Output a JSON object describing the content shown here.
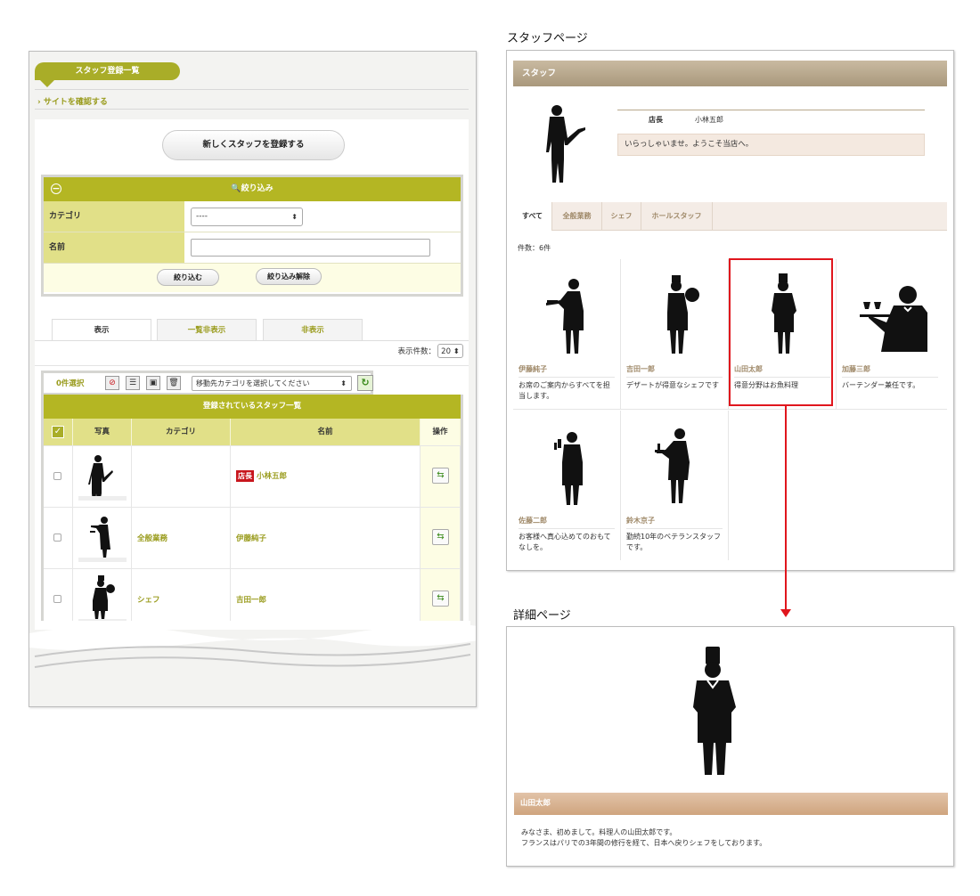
{
  "admin": {
    "tab_title": "スタッフ登録一覧",
    "site_link": "› サイトを確認する",
    "new_button": "新しくスタッフを登録する",
    "filter": {
      "title": "🔍絞り込み",
      "category_label": "カテゴリ",
      "category_value": "----",
      "name_label": "名前",
      "name_value": "",
      "apply_button": "絞り込む",
      "clear_button": "絞り込み解除"
    },
    "tabs": [
      "表示",
      "一覧非表示",
      "非表示"
    ],
    "per_page_label": "表示件数：",
    "per_page_value": "20",
    "toolbar": {
      "selected_count": "0件選択",
      "move_category_placeholder": "移動先カテゴリを選択してください"
    },
    "table": {
      "title": "登録されているスタッフ一覧",
      "columns": [
        "写真",
        "カテゴリ",
        "名前",
        "操作"
      ],
      "rows": [
        {
          "category": "",
          "badge": "店長",
          "name": "小林五郎"
        },
        {
          "category": "全般業務",
          "badge": "",
          "name": "伊藤純子"
        },
        {
          "category": "シェフ",
          "badge": "",
          "name": "吉田一郎"
        }
      ]
    }
  },
  "staff_page": {
    "caption": "スタッフページ",
    "header": "スタッフ",
    "manager": {
      "role": "店長",
      "name": "小林五郎",
      "greeting": "いらっしゃいませ。ようこそ当店へ。"
    },
    "tabs": [
      "すべて",
      "全般業務",
      "シェフ",
      "ホールスタッフ"
    ],
    "count": "件数：6件",
    "staff": [
      {
        "name": "伊藤純子",
        "desc": "お席のご案内からすべてを担当します。"
      },
      {
        "name": "吉田一郎",
        "desc": "デザートが得意なシェフです"
      },
      {
        "name": "山田太郎",
        "desc": "得意分野はお魚料理"
      },
      {
        "name": "加藤三郎",
        "desc": "バーテンダー兼任です。"
      },
      {
        "name": "佐藤二郎",
        "desc": "お客様へ真心込めてのおもてなしを。"
      },
      {
        "name": "鈴木京子",
        "desc": "勤続10年のベテランスタッフです。"
      }
    ]
  },
  "detail_page": {
    "caption": "詳細ページ",
    "name": "山田太郎",
    "text_line1": "みなさま、初めまして。料理人の山田太郎です。",
    "text_line2": "フランスはパリでの3年間の修行を経て、日本へ戻りシェフをしております。"
  },
  "colors": {
    "olive": "#b4b623",
    "olive_light": "#e1e088",
    "tan": "#a9987c",
    "highlight": "#e0161d"
  }
}
